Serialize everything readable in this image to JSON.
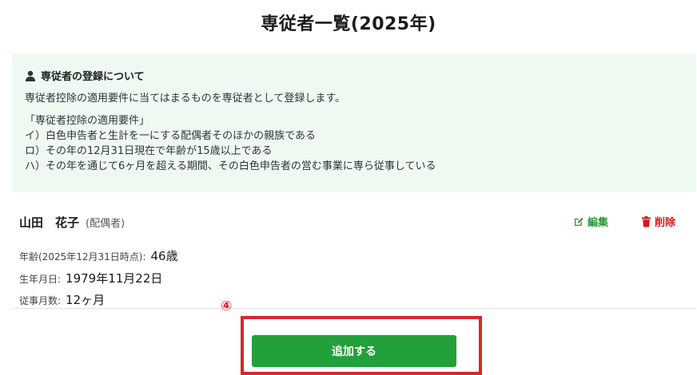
{
  "page": {
    "title": "専従者一覧(2025年)"
  },
  "info": {
    "icon": "person-icon",
    "heading": "専従者の登録について",
    "lead": "専従者控除の適用要件に当てはまるものを専従者として登録します。",
    "requirements_title": "「専従者控除の適用要件」",
    "requirements": [
      "イ）白色申告者と生計を一にする配偶者そのほかの親族である",
      "ロ）その年の12月31日現在で年齢が15歳以上である",
      "ハ）その年を通じて6ヶ月を超える期間、その白色申告者の営む事業に専ら従事している"
    ],
    "background_color": "#eefaf1"
  },
  "dependent": {
    "name": "山田　花子",
    "relation": "(配偶者)",
    "edit_label": "編集",
    "edit_icon": "edit-icon",
    "delete_label": "削除",
    "delete_icon": "trash-icon",
    "fields": {
      "age_label": "年齢(2025年12月31日時点):",
      "age_value": "46歳",
      "birthdate_label": "生年月日:",
      "birthdate_value": "1979年11月22日",
      "months_label": "従事月数:",
      "months_value": "12ヶ月"
    }
  },
  "annotation": {
    "marker": "④",
    "color": "#d9262c"
  },
  "actions": {
    "add_label": "追加する",
    "add_color": "#22a03a"
  }
}
